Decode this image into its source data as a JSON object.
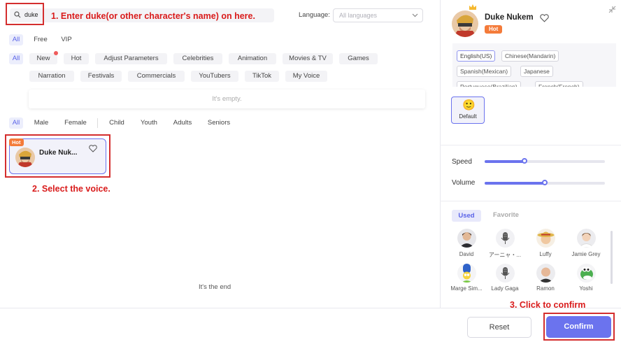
{
  "search": {
    "value": "duke"
  },
  "annotations": {
    "step1": "1. Enter duke(or other character's name) on here.",
    "step2": "2. Select the voice.",
    "step3": "3. Click to confirm"
  },
  "language": {
    "label": "Language:",
    "placeholder": "All languages"
  },
  "price_filters": [
    "All",
    "Free",
    "VIP"
  ],
  "categories": {
    "all": "All",
    "row1": [
      "New",
      "Hot",
      "Adjust Parameters",
      "Celebrities",
      "Animation",
      "Movies & TV",
      "Games"
    ],
    "row2": [
      "Narration",
      "Festivals",
      "Commercials",
      "YouTubers",
      "TikTok",
      "My Voice"
    ]
  },
  "empty_text": "It's empty.",
  "gender_filters": [
    "All",
    "Male",
    "Female"
  ],
  "age_filters": [
    "Child",
    "Youth",
    "Adults",
    "Seniors"
  ],
  "result_card": {
    "badge": "Hot",
    "name": "Duke Nuk..."
  },
  "end_text": "It's the end",
  "detail": {
    "name": "Duke Nukem",
    "badge": "Hot",
    "languages": [
      "English(US)",
      "Chinese(Mandarin)",
      "Spanish(Mexican)",
      "Japanese",
      "Portuguese(Brazilian)",
      "French(French)"
    ],
    "style": {
      "emoji": "🙂",
      "label": "Default"
    },
    "speed_label": "Speed",
    "volume_label": "Volume",
    "speed_value": 0.33,
    "volume_value": 0.5
  },
  "voice_tabs": {
    "used": "Used",
    "favorite": "Favorite"
  },
  "used_voices": [
    "David",
    "アーニャ・...",
    "Luffy",
    "Jamie Grey",
    "Marge Sim...",
    "Lady Gaga",
    "Ramon",
    "Yoshi"
  ],
  "buttons": {
    "reset": "Reset",
    "confirm": "Confirm"
  },
  "colors": {
    "accent": "#6b73ee",
    "hot": "#f47b3a",
    "annotation": "#d91b1b"
  }
}
